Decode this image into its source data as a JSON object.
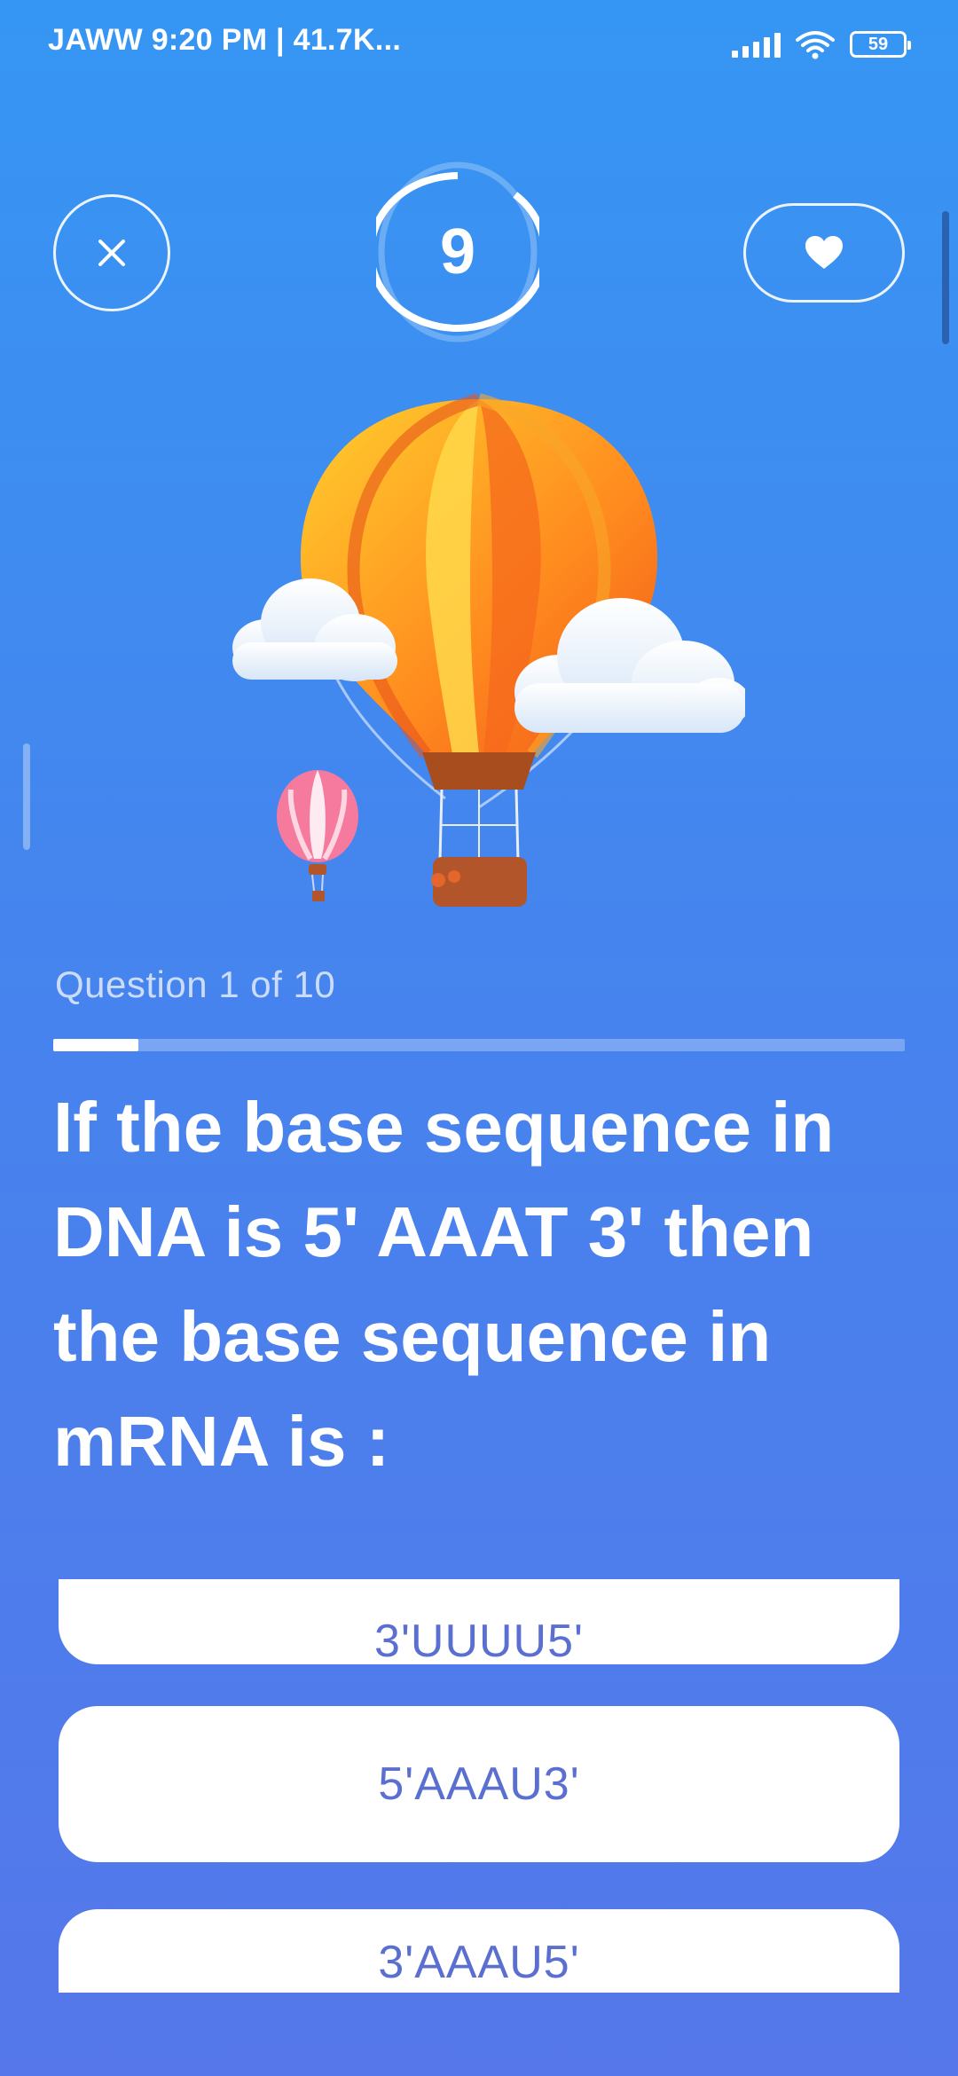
{
  "status_bar": {
    "left_text": "JAWW  9:20 PM | 41.7K...",
    "battery": "59"
  },
  "header": {
    "timer_value": "9",
    "timer_progress": 0.12
  },
  "quiz": {
    "counter": "Question 1 of 10",
    "progress": 0.1,
    "question": "If the base sequence in DNA is 5' AAAT 3' then the base sequence in mRNA is :",
    "answers": [
      "3'UUUU5'",
      "5'AAAU3'",
      "3'AAAU5'"
    ]
  },
  "icons": {
    "close": "close-icon",
    "heart": "heart-icon",
    "illustration": "hot-air-balloon-illustration"
  }
}
